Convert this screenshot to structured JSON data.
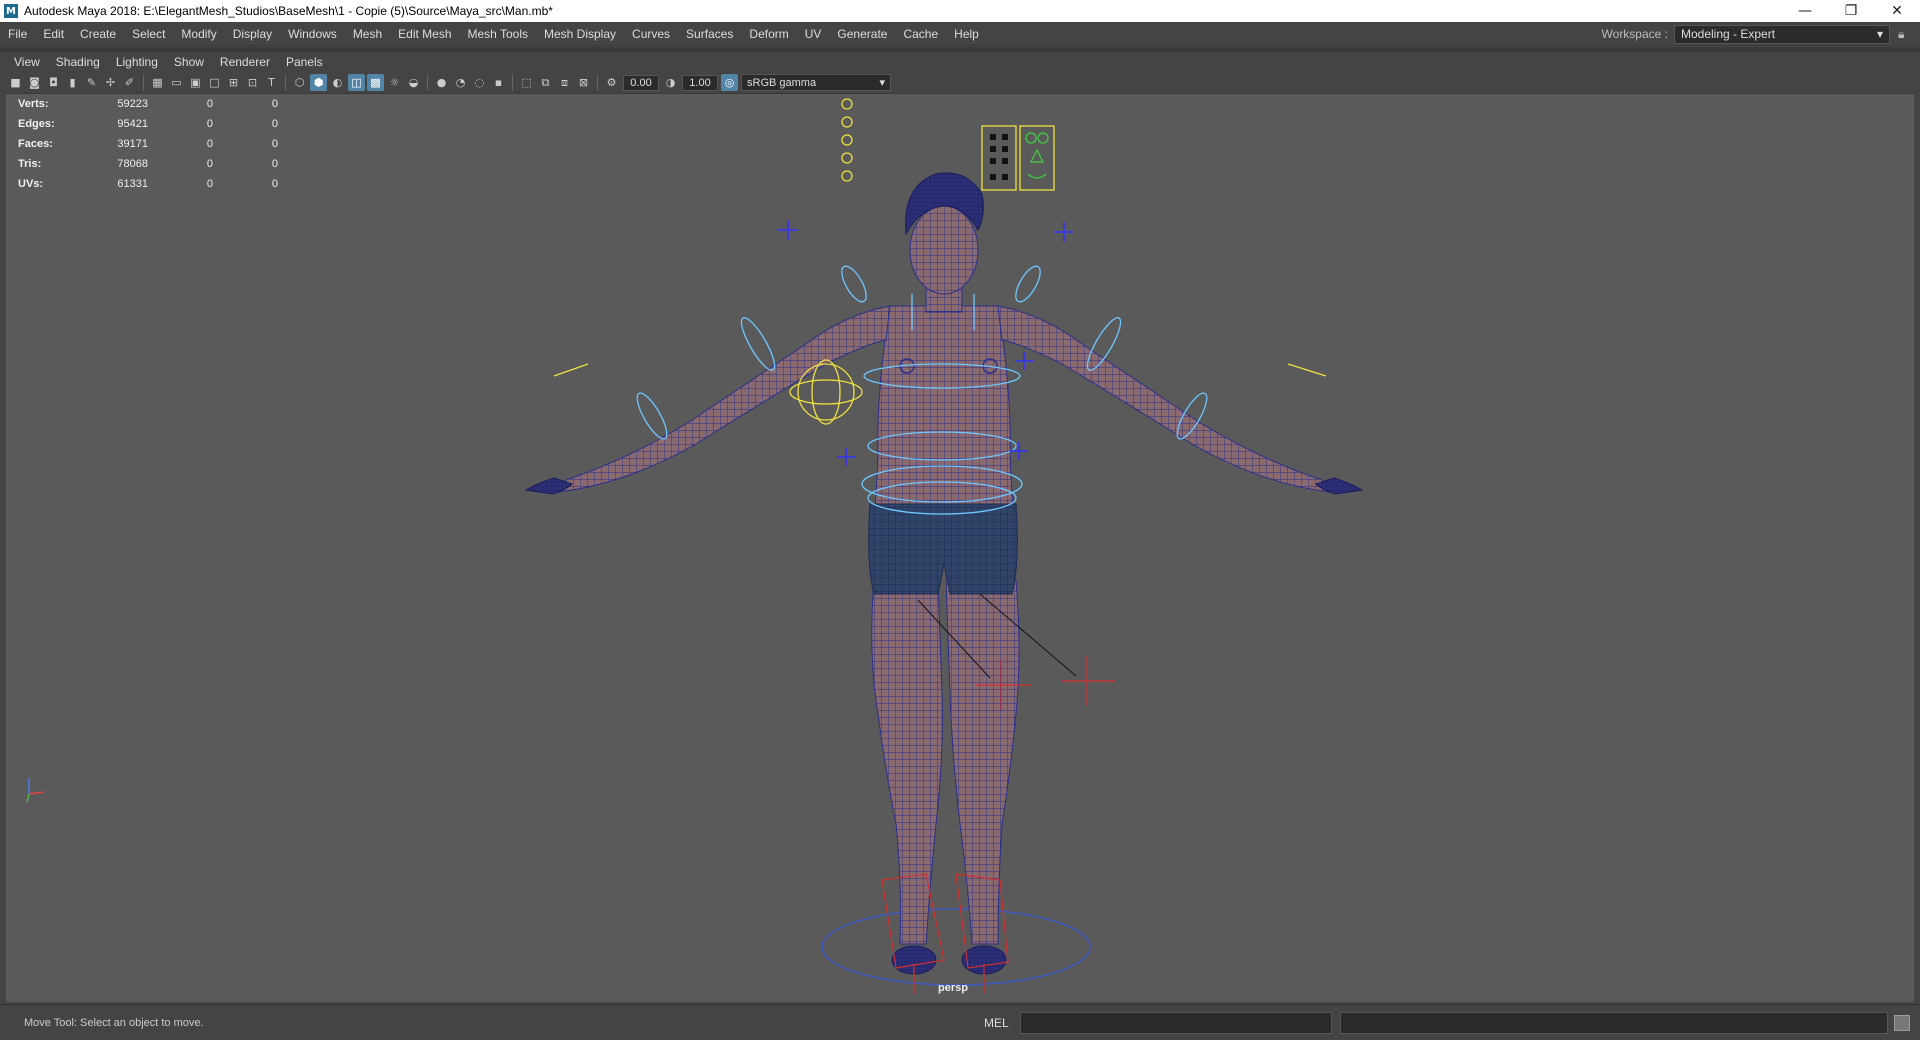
{
  "window": {
    "title": "Autodesk Maya 2018: E:\\ElegantMesh_Studios\\BaseMesh\\1 - Copie (5)\\Source\\Maya_src\\Man.mb*",
    "app_icon_letter": "M",
    "minimize": "—",
    "restore": "❐",
    "close": "✕"
  },
  "menubar": {
    "items": [
      "File",
      "Edit",
      "Create",
      "Select",
      "Modify",
      "Display",
      "Windows",
      "Mesh",
      "Edit Mesh",
      "Mesh Tools",
      "Mesh Display",
      "Curves",
      "Surfaces",
      "Deform",
      "UV",
      "Generate",
      "Cache",
      "Help"
    ],
    "workspace_label": "Workspace :",
    "workspace_value": "Modeling - Expert"
  },
  "panel_menubar": {
    "items": [
      "View",
      "Shading",
      "Lighting",
      "Show",
      "Renderer",
      "Panels"
    ]
  },
  "panel_toolbar": {
    "exposure": "0.00",
    "gamma": "1.00",
    "color_space": "sRGB gamma"
  },
  "hud": {
    "rows": [
      {
        "label": "Verts:",
        "v1": "59223",
        "v2": "0",
        "v3": "0"
      },
      {
        "label": "Edges:",
        "v1": "95421",
        "v2": "0",
        "v3": "0"
      },
      {
        "label": "Faces:",
        "v1": "39171",
        "v2": "0",
        "v3": "0"
      },
      {
        "label": "Tris:",
        "v1": "78068",
        "v2": "0",
        "v3": "0"
      },
      {
        "label": "UVs:",
        "v1": "61331",
        "v2": "0",
        "v3": "0"
      }
    ]
  },
  "viewport": {
    "camera": "persp",
    "mesh_color": "#8a6a6e",
    "wire_color": "#2a2f8a",
    "shorts_color": "#2f4466",
    "control_cyan": "#6ec6ff",
    "control_yellow": "#f0e040",
    "locator_red": "#d03030",
    "locator_blue": "#3a3ad8"
  },
  "statusbar": {
    "help_line": "Move Tool: Select an object to move.",
    "mel_label": "MEL"
  }
}
